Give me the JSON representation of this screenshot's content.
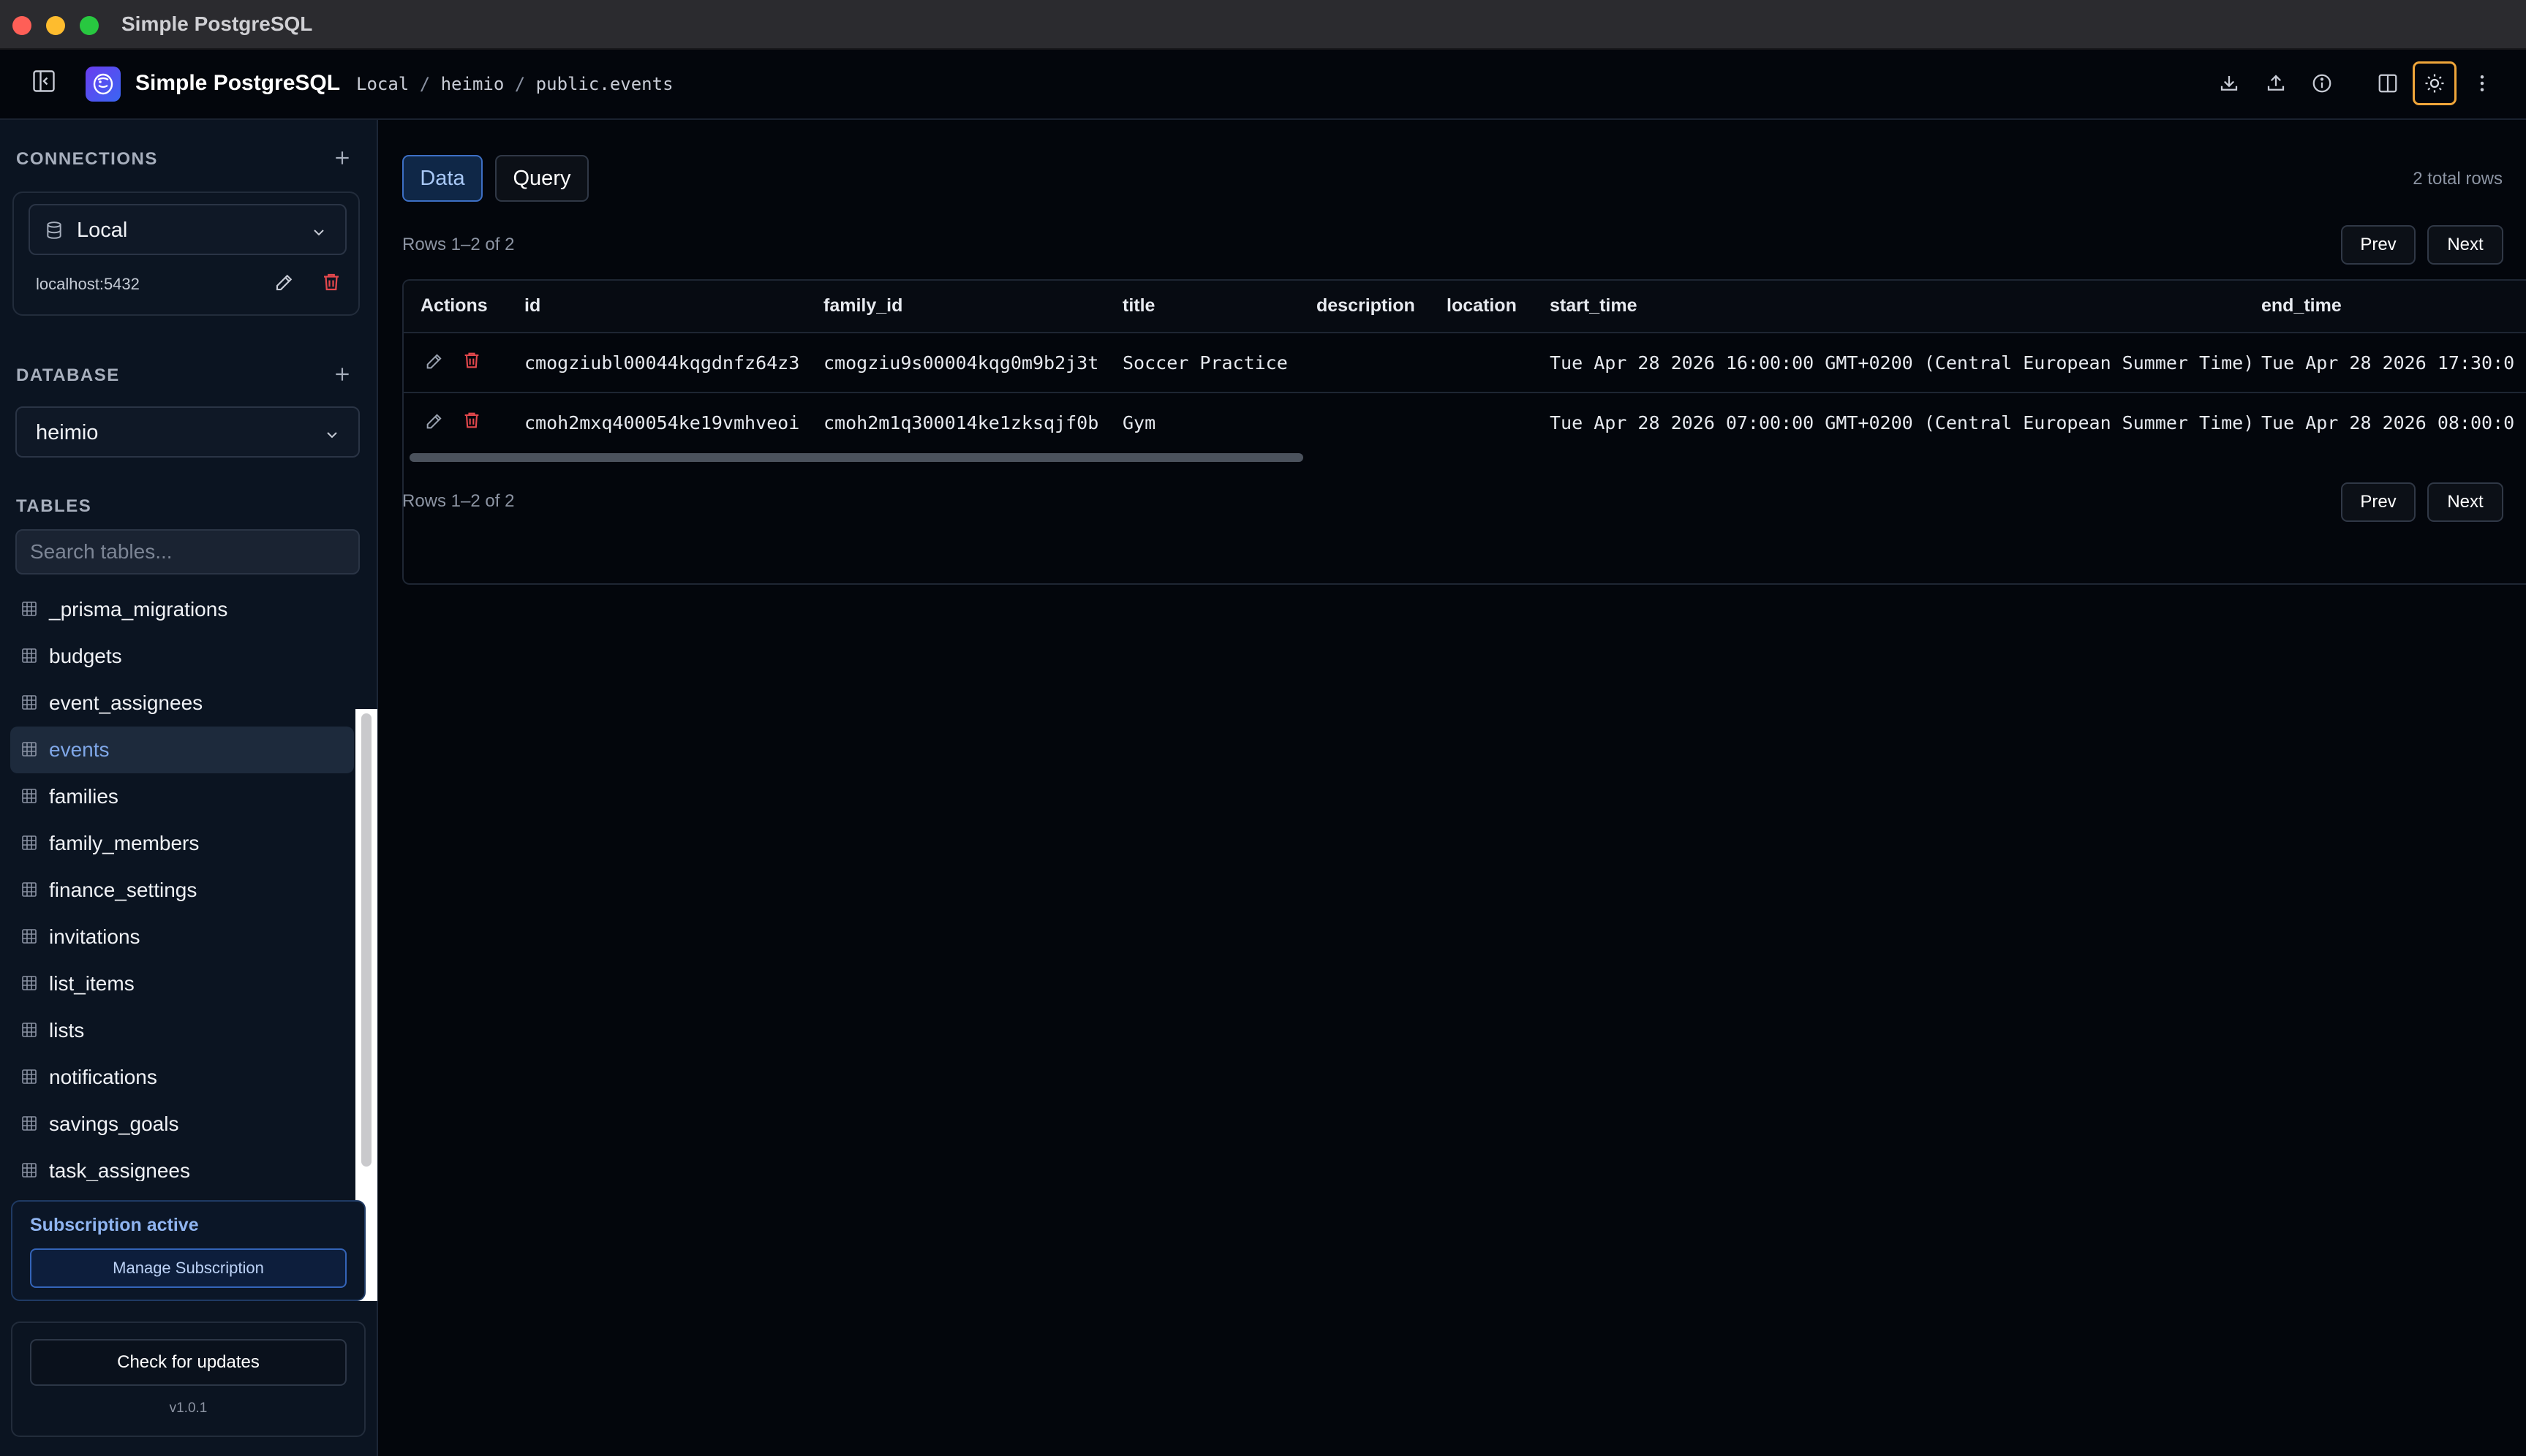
{
  "window": {
    "title": "Simple PostgreSQL"
  },
  "header": {
    "app_name": "Simple PostgreSQL",
    "breadcrumb": [
      "Local",
      "heimio",
      "public.events"
    ],
    "breadcrumb_separator": "/",
    "actions": [
      "download-icon",
      "upload-icon",
      "info-icon",
      "columns-icon",
      "sun-icon",
      "more-vertical-icon"
    ]
  },
  "sidebar": {
    "connections": {
      "label": "CONNECTIONS",
      "selected": "Local",
      "host": "localhost:5432"
    },
    "database": {
      "label": "DATABASE",
      "selected": "heimio"
    },
    "tables": {
      "label": "TABLES",
      "search_placeholder": "Search tables...",
      "items": [
        "_prisma_migrations",
        "budgets",
        "event_assignees",
        "events",
        "families",
        "family_members",
        "finance_settings",
        "invitations",
        "list_items",
        "lists",
        "notifications",
        "savings_goals",
        "task_assignees"
      ],
      "selected": "events"
    },
    "subscription": {
      "status": "Subscription active",
      "manage_label": "Manage Subscription"
    },
    "updates": {
      "check_label": "Check for updates",
      "version": "v1.0.1"
    }
  },
  "main": {
    "tabs": {
      "data": "Data",
      "query": "Query"
    },
    "total_rows": "2 total rows",
    "rows_info": "Rows 1–2 of 2",
    "prev_label": "Prev",
    "next_label": "Next",
    "columns": [
      "Actions",
      "id",
      "family_id",
      "title",
      "description",
      "location",
      "start_time",
      "end_time"
    ],
    "rows": [
      {
        "id": "cmogziubl00044kqgdnfz64z3",
        "family_id": "cmogziu9s00004kqg0m9b2j3t",
        "title": "Soccer Practice",
        "description": "",
        "location": "",
        "start_time": "Tue Apr 28 2026 16:00:00 GMT+0200 (Central European Summer Time)",
        "end_time": "Tue Apr 28 2026 17:30:0"
      },
      {
        "id": "cmoh2mxq400054ke19vmhveoi",
        "family_id": "cmoh2m1q300014ke1zksqjf0b",
        "title": "Gym",
        "description": "",
        "location": "",
        "start_time": "Tue Apr 28 2026 07:00:00 GMT+0200 (Central European Summer Time)",
        "end_time": "Tue Apr 28 2026 08:00:0"
      }
    ]
  },
  "colors": {
    "accent": "#3d6fc4",
    "focus_ring": "#f0a63a",
    "delete": "#e5484d",
    "background": "#03060c",
    "sidebar": "#0b1421"
  }
}
